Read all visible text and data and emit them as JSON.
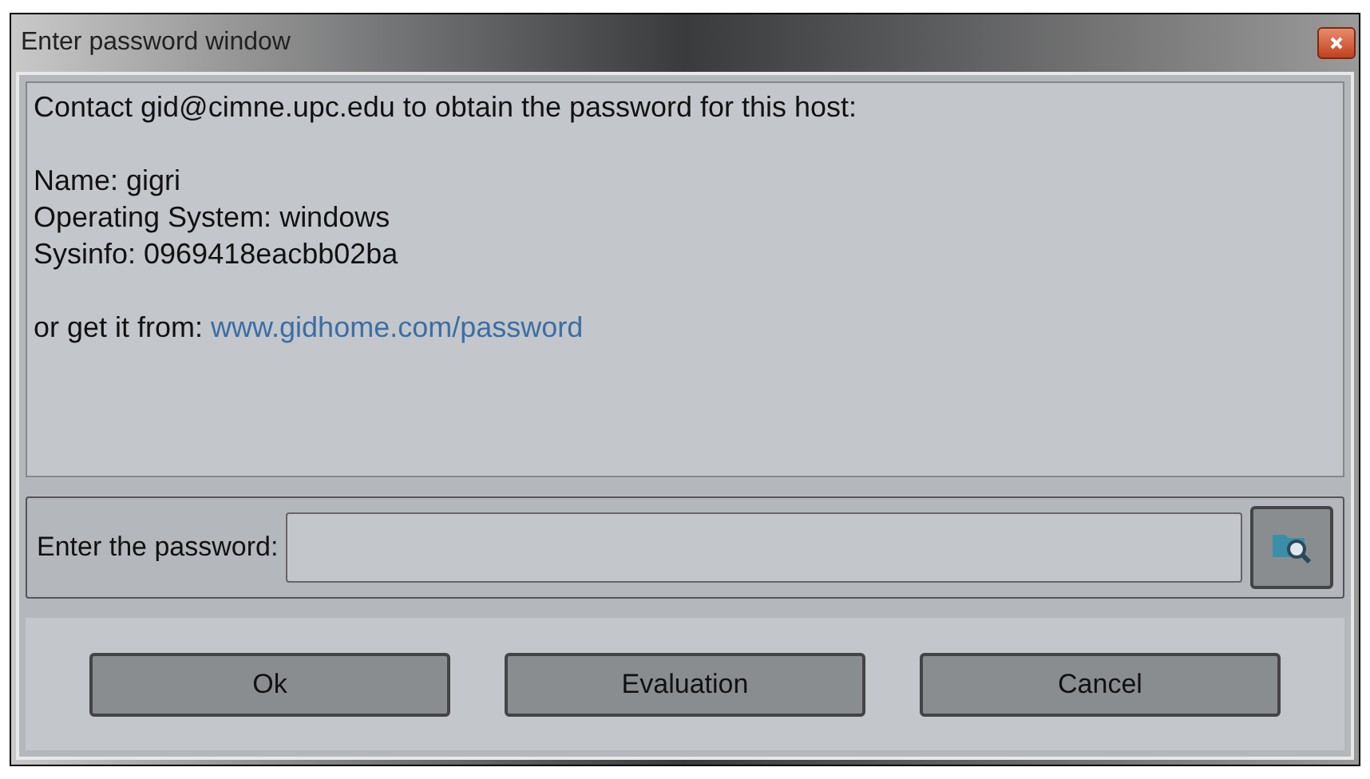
{
  "window": {
    "title": "Enter password window"
  },
  "info": {
    "message": "Contact gid@cimne.upc.edu to obtain the password for this host:",
    "details": [
      "Name: gigri",
      "Operating System: windows",
      "Sysinfo: 0969418eacbb02ba"
    ],
    "link_prefix": "or get it from:",
    "link": "www.gidhome.com/password"
  },
  "password": {
    "label": "Enter the password:"
  },
  "buttons": [
    "Ok",
    "Evaluation",
    "Cancel"
  ]
}
